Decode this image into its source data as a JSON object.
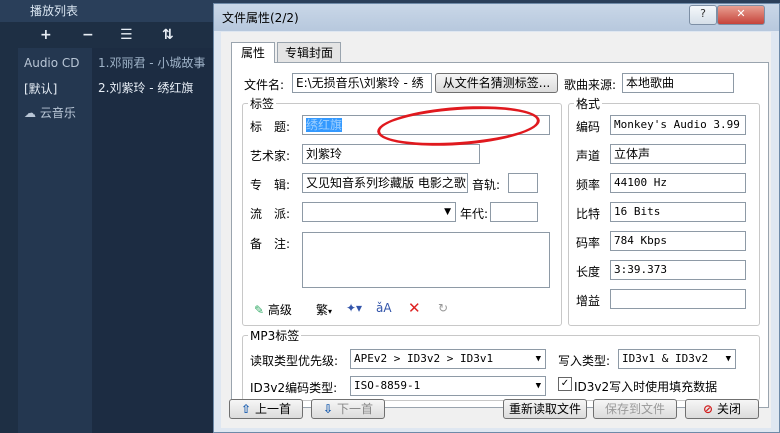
{
  "playlist": {
    "title": "播放列表",
    "toolbar": [
      "+",
      "−",
      "☰",
      "⇅"
    ],
    "left_items": [
      "Audio CD",
      "[默认]",
      "云音乐"
    ],
    "songs": [
      "1.邓丽君 - 小城故事",
      "2.刘紫玲 - 绣红旗"
    ]
  },
  "dialog": {
    "title": "文件属性(2/2)",
    "help": "?",
    "close": "✕",
    "tabs": [
      "属性",
      "专辑封面"
    ],
    "filename_label": "文件名:",
    "filename_value": "E:\\无损音乐\\刘紫玲 - 绣",
    "guess_button": "从文件名猜测标签...",
    "source_label": "歌曲来源:",
    "source_value": "本地歌曲",
    "tag_group": "标签",
    "title_label": "标　题:",
    "title_value": "绣红旗",
    "artist_label": "艺术家:",
    "artist_value": "刘紫玲",
    "album_label": "专　辑:",
    "album_value": "又见知音系列珍藏版 电影之歌",
    "track_label": "音轨:",
    "track_value": "",
    "genre_label": "流　派:",
    "genre_value": "",
    "year_label": "年代:",
    "year_value": "",
    "comment_label": "备　注:",
    "comment_value": "",
    "advanced_button": "高级",
    "trad_button": "繁",
    "format_group": "格式",
    "codec_label": "编码",
    "codec_value": "Monkey's Audio 3.99",
    "channel_label": "声道",
    "channel_value": "立体声",
    "freq_label": "频率",
    "freq_value": "44100 Hz",
    "bits_label": "比特",
    "bits_value": "16 Bits",
    "bitrate_label": "码率",
    "bitrate_value": "784 Kbps",
    "length_label": "长度",
    "length_value": "3:39.373",
    "gain_label": "增益",
    "gain_value": "",
    "mp3_group": "MP3标签",
    "read_priority_label": "读取类型优先级:",
    "read_priority_value": "APEv2 > ID3v2 > ID3v1",
    "write_type_label": "写入类型:",
    "write_type_value": "ID3v1 & ID3v2",
    "id3_enc_label": "ID3v2编码类型:",
    "id3_enc_value": "ISO-8859-1",
    "pad_label": "ID3v2写入时使用填充数据",
    "pad_checked": true,
    "prev_button": "上一首",
    "next_button": "下一首",
    "reread_button": "重新读取文件",
    "save_button": "保存到文件",
    "close_button": "关闭"
  }
}
